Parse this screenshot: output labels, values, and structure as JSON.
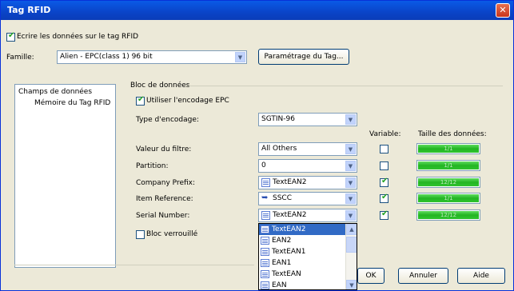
{
  "window": {
    "title": "Tag RFID",
    "close": "✕"
  },
  "write_checkbox": {
    "label": "Ecrire les données sur le tag RFID",
    "checked": true
  },
  "family": {
    "label": "Famille:",
    "value": "Alien - EPC(class 1) 96 bit",
    "settings_button": "Paramétrage du Tag..."
  },
  "tree": {
    "root": "Champs de données",
    "child": "Mémoire du Tag RFID"
  },
  "group": {
    "title": "Bloc de données",
    "use_epc": {
      "label": "Utiliser l'encodage EPC",
      "checked": true
    },
    "encoding": {
      "label": "Type d'encodage:",
      "value": "SGTIN-96"
    },
    "col_variable": "Variable:",
    "col_size": "Taille des données:",
    "rows": [
      {
        "label": "Valeur du filtre:",
        "value": "All Others",
        "icon": "none",
        "variable": false,
        "size": "1/1"
      },
      {
        "label": "Partition:",
        "value": "0",
        "icon": "none",
        "variable": false,
        "size": "1/1"
      },
      {
        "label": "Company Prefix:",
        "value": "TextEAN2",
        "icon": "doc-icon",
        "variable": true,
        "size": "12/12"
      },
      {
        "label": "Item Reference:",
        "value": "SSCC",
        "icon": "ref-icon",
        "variable": true,
        "size": "1/1"
      },
      {
        "label": "Serial Number:",
        "value": "TextEAN2",
        "icon": "doc-icon",
        "variable": true,
        "size": "12/12"
      }
    ],
    "lock_block": {
      "label": "Bloc verrouillé",
      "checked": false
    }
  },
  "dropdown": {
    "items": [
      "TextEAN2",
      "EAN2",
      "TextEAN1",
      "EAN1",
      "TextEAN",
      "EAN"
    ],
    "selected_index": 0
  },
  "buttons": {
    "ok": "OK",
    "cancel": "Annuler",
    "help": "Aide"
  },
  "colors": {
    "title_bar": "#0a44c8",
    "selection": "#316ac5",
    "progress": "#23b523"
  }
}
